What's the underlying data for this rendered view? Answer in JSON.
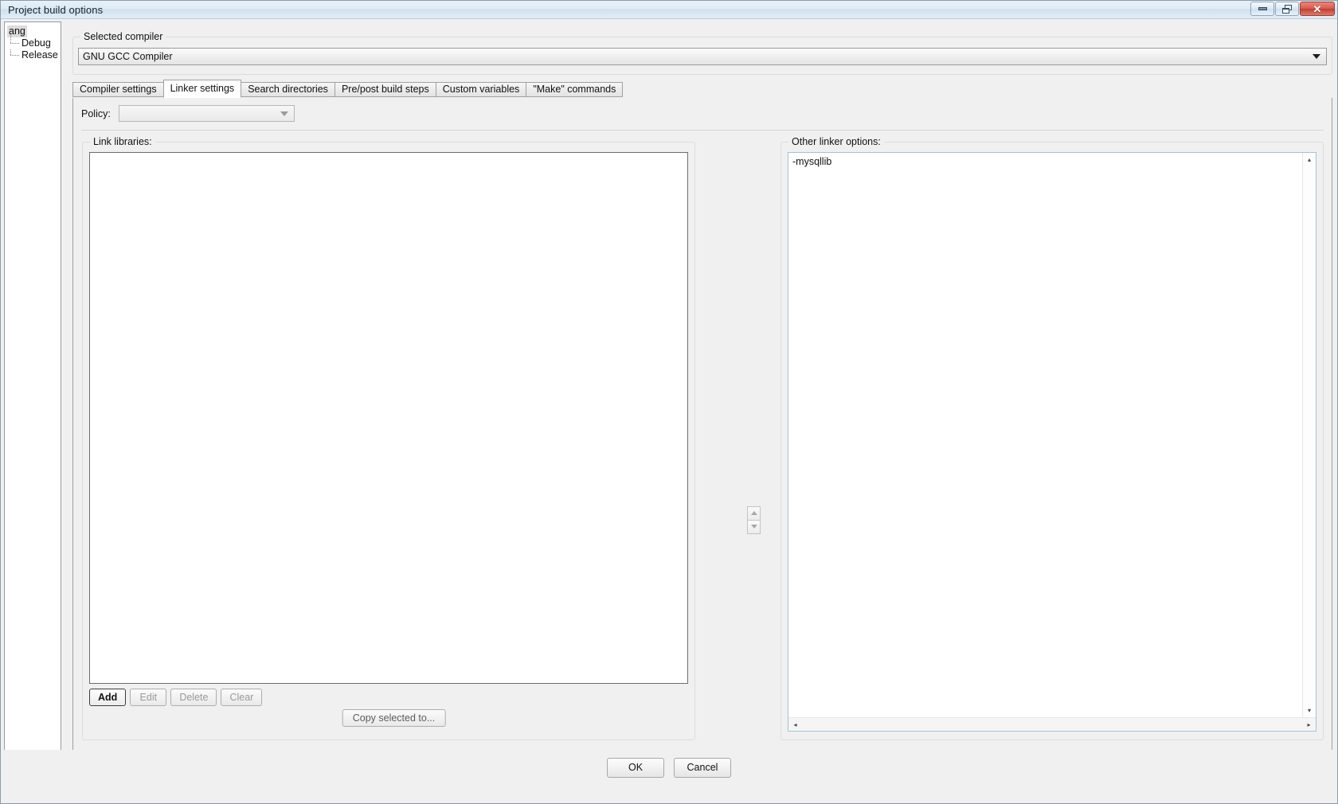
{
  "window": {
    "title": "Project build options",
    "buttons": {
      "minimize": "minimize",
      "restore": "restore",
      "close": "✕"
    }
  },
  "tree": {
    "root": "ang",
    "children": [
      "Debug",
      "Release"
    ]
  },
  "scrollbar": {
    "left_arrow": "◂",
    "right_arrow": "▸",
    "up_arrow": "▴",
    "down_arrow": "▾",
    "thumb_grip": "|||"
  },
  "compiler": {
    "group_label": "Selected compiler",
    "selected": "GNU GCC Compiler"
  },
  "tabs": [
    {
      "label": "Compiler settings",
      "active": false
    },
    {
      "label": "Linker settings",
      "active": true
    },
    {
      "label": "Search directories",
      "active": false
    },
    {
      "label": "Pre/post build steps",
      "active": false
    },
    {
      "label": "Custom variables",
      "active": false
    },
    {
      "label": "\"Make\" commands",
      "active": false
    }
  ],
  "policy": {
    "label": "Policy:",
    "value": ""
  },
  "link_libraries": {
    "group_label": "Link libraries:",
    "items": [],
    "buttons": {
      "add": "Add",
      "edit": "Edit",
      "delete": "Delete",
      "clear": "Clear",
      "copy_selected": "Copy selected to..."
    }
  },
  "other_linker_options": {
    "group_label": "Other linker options:",
    "value": "-mysqllib"
  },
  "footer": {
    "ok": "OK",
    "cancel": "Cancel"
  }
}
